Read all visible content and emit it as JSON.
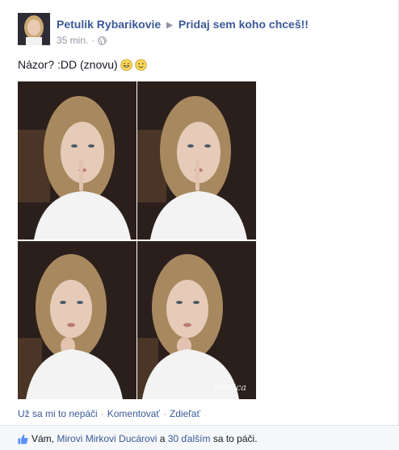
{
  "post": {
    "author": "Petulik Rybarikovie",
    "group": "Pridaj sem koho chceš!!",
    "time": "35 min.",
    "meta_dot": "·",
    "text": "Názor? :DD (znovu)",
    "watermark": "Retrica"
  },
  "actions": {
    "like": "Už sa mi to nepáči",
    "comment": "Komentovať",
    "share": "Zdieľať",
    "sep": "·"
  },
  "likes": {
    "you": "Vám,",
    "person": "Mirovi Mirkovi Ducárovi",
    "and": "a",
    "others": "30 ďalším",
    "suffix": "sa to páči."
  },
  "icons": {
    "arrow": "right-triangle-icon",
    "globe": "globe-icon",
    "emoji1": "grinning-emoji-icon",
    "emoji2": "smiling-emoji-icon",
    "thumb": "thumbs-up-icon"
  },
  "colors": {
    "link": "#3b5998",
    "muted": "#9197a3",
    "text": "#141823",
    "likes_bg": "#f6f7f9"
  }
}
